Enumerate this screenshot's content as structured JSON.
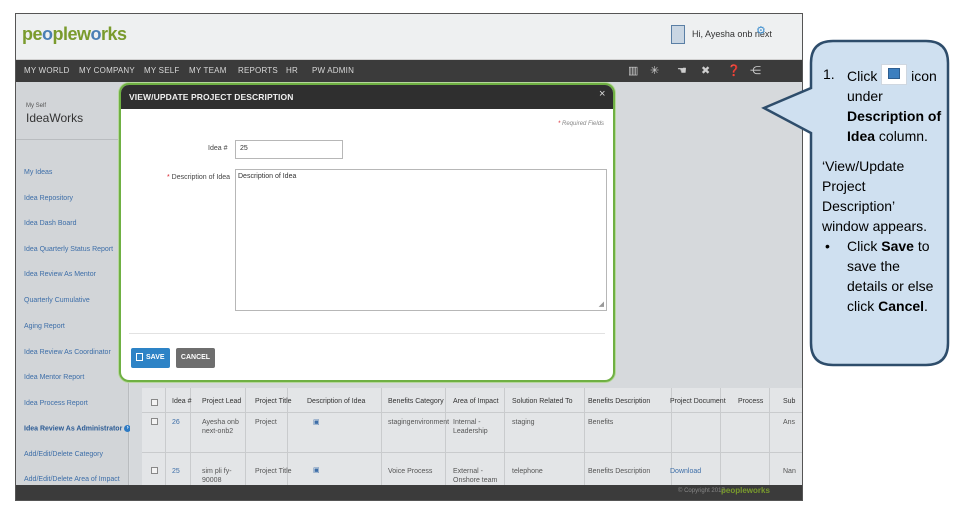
{
  "app": {
    "logo": "peopleworks",
    "greeting": "Hi, Ayesha onb next",
    "nav": [
      "MY WORLD",
      "MY COMPANY",
      "MY SELF",
      "MY TEAM",
      "REPORTS",
      "HR",
      "PW ADMIN"
    ],
    "nav_icons": [
      "book-icon",
      "sun-icon",
      "hand-icon",
      "tools-icon",
      "help-icon",
      "share-icon"
    ]
  },
  "sidebar": {
    "crumb": "My Self",
    "title": "IdeaWorks",
    "items": [
      "My Ideas",
      "Idea Repository",
      "Idea Dash Board",
      "Idea Quarterly Status Report",
      "Idea Review As Mentor",
      "Quarterly Cumulative",
      "Aging Report",
      "Idea Review As Coordinator",
      "Idea Mentor Report",
      "Idea Process Report",
      "Idea Review As Administrator",
      "Add/Edit/Delete Category",
      "Add/Edit/Delete Area of Impact"
    ]
  },
  "table": {
    "headers": [
      "Idea #",
      "Project Lead",
      "Project Title",
      "Description of Idea",
      "Benefits Category",
      "Area of Impact",
      "Solution Related To",
      "Benefits Description",
      "Project Document",
      "Process",
      "Sub"
    ],
    "rows": [
      {
        "idea": "26",
        "lead": "Ayesha onb next-onb2",
        "title": "Project",
        "category": "stagingenvironment",
        "impact": "Internal - Leadership",
        "solution": "staging",
        "benefits": "Benefits",
        "document": "",
        "sub": "Ans"
      },
      {
        "idea": "25",
        "lead": "sim pli fy-90008",
        "title": "Project Title",
        "category": "Voice Process",
        "impact": "External - Onshore team",
        "solution": "telephone",
        "benefits": "Benefits Description",
        "document": "Download",
        "sub": "Nan"
      }
    ]
  },
  "footer": {
    "copyright": "© Copyright 2017",
    "logo": "peopleworks"
  },
  "modal": {
    "title": "VIEW/UPDATE PROJECT DESCRIPTION",
    "close": "×",
    "required_note": "Required Fields",
    "idea_label": "Idea #",
    "idea_value": "25",
    "desc_label": "Description of Idea",
    "desc_value": "Description of Idea",
    "save_label": "SAVE",
    "cancel_label": "CANCEL"
  },
  "callout": {
    "step_number": "1.",
    "step_click": "Click",
    "step_text_1": "icon under",
    "step_bold": "Description of Idea",
    "step_text_2": "column.",
    "note": "‘View/Update Project Description’ window appears.",
    "bullet_click": "Click",
    "bullet_save": "Save",
    "bullet_text": "to save the details or else click",
    "bullet_cancel": "Cancel",
    "bullet_end": "."
  },
  "colors": {
    "accent": "#6fb043",
    "primary_button": "#2d83c6",
    "callout_fill": "#cfe0f0",
    "callout_border": "#2e4d6b"
  }
}
